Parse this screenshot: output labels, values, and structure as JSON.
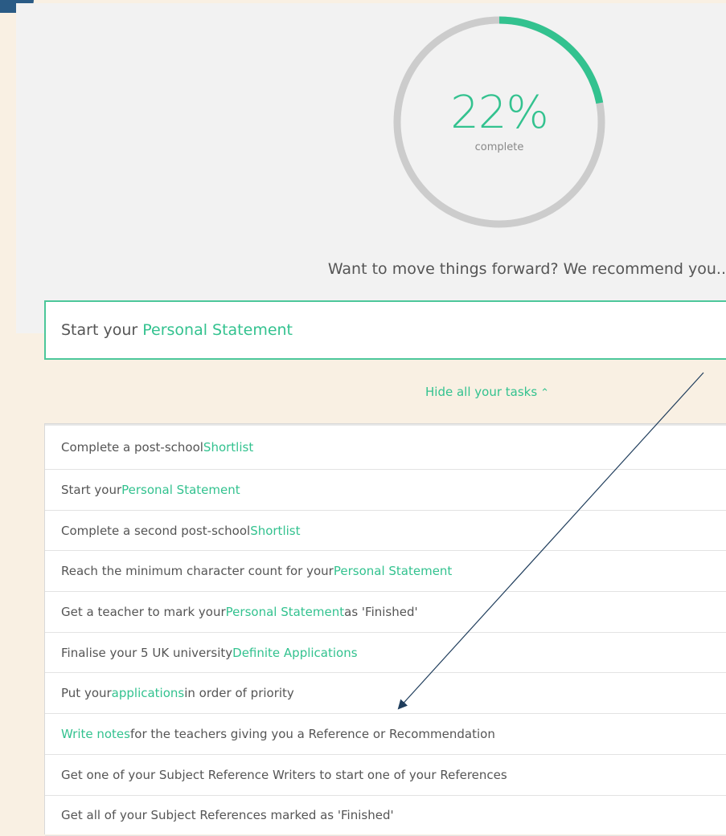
{
  "progress": {
    "percent_text": "22%",
    "percent_value": 22,
    "label": "complete",
    "colors": {
      "filled": "#33c28f",
      "track": "#cccccc"
    }
  },
  "recommendation": {
    "prompt": "Want to move things forward? We recommend you..",
    "task": {
      "prefix": "Start your ",
      "link": "Personal Statement"
    }
  },
  "toggle": {
    "label": "Hide all your tasks",
    "icon": "chevron-up-icon"
  },
  "tasks": [
    {
      "before": "Complete a post-school ",
      "link": "Shortlist",
      "after": ""
    },
    {
      "before": "Start your ",
      "link": "Personal Statement",
      "after": ""
    },
    {
      "before": "Complete a second post-school ",
      "link": "Shortlist",
      "after": ""
    },
    {
      "before": "Reach the minimum character count for your ",
      "link": "Personal Statement",
      "after": ""
    },
    {
      "before": "Get a teacher to mark your ",
      "link": "Personal Statement",
      "after": " as 'Finished'"
    },
    {
      "before": "Finalise your 5 UK university ",
      "link": "Definite Applications",
      "after": ""
    },
    {
      "before": "Put your ",
      "link": "applications",
      "after": " in order of priority"
    },
    {
      "before": "",
      "link": "Write notes",
      "after": " for the teachers giving you a Reference or Recommendation"
    },
    {
      "before": "Get one of your Subject Reference Writers to start one of your References",
      "link": "",
      "after": ""
    },
    {
      "before": "Get all of your Subject References marked as 'Finished'",
      "link": "",
      "after": ""
    }
  ],
  "annotation": {
    "color": "#1f3d5c"
  }
}
